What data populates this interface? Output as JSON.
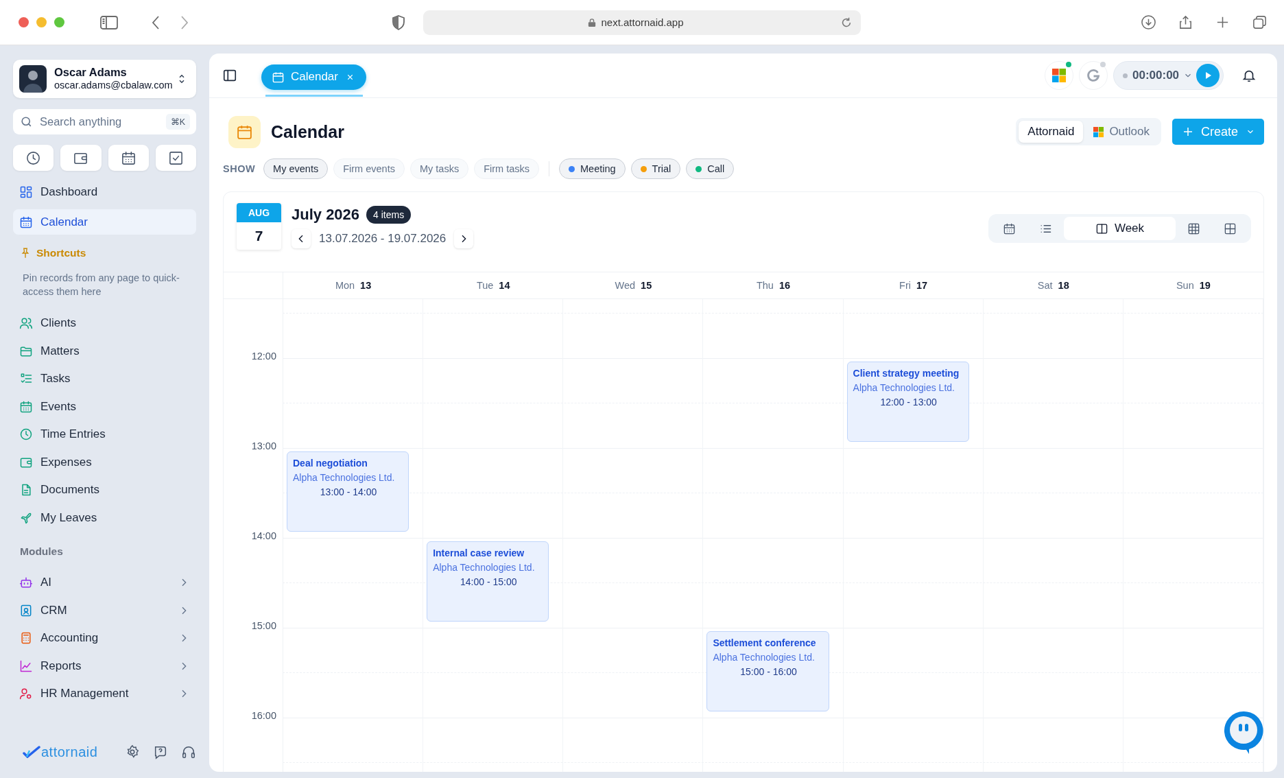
{
  "browser": {
    "url": "next.attornaid.app"
  },
  "user": {
    "name": "Oscar Adams",
    "email": "oscar.adams@cbalaw.com"
  },
  "search": {
    "placeholder": "Search anything",
    "shortcut": "⌘K"
  },
  "nav": [
    {
      "label": "Dashboard",
      "selected": false
    },
    {
      "label": "Calendar",
      "selected": true
    }
  ],
  "shortcuts": {
    "title": "Shortcuts",
    "hint": "Pin records from any page to quick-access them here"
  },
  "records": [
    "Clients",
    "Matters",
    "Tasks",
    "Events",
    "Time Entries",
    "Expenses",
    "Documents",
    "My Leaves"
  ],
  "modules": {
    "title": "Modules",
    "items": [
      "AI",
      "CRM",
      "Accounting",
      "Reports",
      "HR Management"
    ]
  },
  "brand": "attornaid",
  "tabs": [
    {
      "label": "Calendar",
      "selected": true
    }
  ],
  "integrations": [
    {
      "kind": "microsoft",
      "connected": true
    },
    {
      "kind": "google",
      "connected": false
    }
  ],
  "timer": {
    "value": "00:00:00"
  },
  "page": {
    "title": "Calendar"
  },
  "sources": [
    {
      "label": "Attornaid",
      "selected": true
    },
    {
      "label": "Outlook",
      "selected": false
    }
  ],
  "create_button": "Create",
  "filters": {
    "label": "SHOW",
    "items": [
      {
        "label": "My events",
        "selected": true
      },
      {
        "label": "Firm events",
        "selected": false
      },
      {
        "label": "My tasks",
        "selected": false
      },
      {
        "label": "Firm tasks",
        "selected": false
      }
    ]
  },
  "legend": [
    {
      "label": "Meeting",
      "color": "#3b82f6"
    },
    {
      "label": "Trial",
      "color": "#f59e0b"
    },
    {
      "label": "Call",
      "color": "#10b981"
    }
  ],
  "calendar": {
    "today": {
      "month": "AUG",
      "day": "7"
    },
    "title": "July 2026",
    "count": "4 items",
    "range": "13.07.2026 - 19.07.2026",
    "views": [
      {
        "kind": "calendar",
        "selected": false
      },
      {
        "kind": "list",
        "selected": false
      },
      {
        "kind": "week",
        "label": "Week",
        "selected": true
      },
      {
        "kind": "month",
        "selected": false
      },
      {
        "kind": "grid",
        "selected": false
      }
    ],
    "time_labels": [
      "12:00",
      "13:00",
      "14:00",
      "15:00",
      "16:00"
    ],
    "days": [
      {
        "name": "Mon",
        "date": "13",
        "events": [
          {
            "title": "Deal negotiation",
            "client": "Alpha Technologies Ltd.",
            "time": "13:00 - 14:00"
          }
        ]
      },
      {
        "name": "Tue",
        "date": "14",
        "events": [
          {
            "title": "Internal case review",
            "client": "Alpha Technologies Ltd.",
            "time": "14:00 - 15:00"
          }
        ]
      },
      {
        "name": "Wed",
        "date": "15"
      },
      {
        "name": "Thu",
        "date": "16",
        "events": [
          {
            "title": "Settlement conference",
            "client": "Alpha Technologies Ltd.",
            "time": "15:00 - 16:00"
          }
        ]
      },
      {
        "name": "Fri",
        "date": "17",
        "events": [
          {
            "title": "Client strategy meeting",
            "client": "Alpha Technologies Ltd.",
            "time": "12:00 - 13:00"
          }
        ]
      },
      {
        "name": "Sat",
        "date": "18"
      },
      {
        "name": "Sun",
        "date": "19"
      }
    ]
  }
}
